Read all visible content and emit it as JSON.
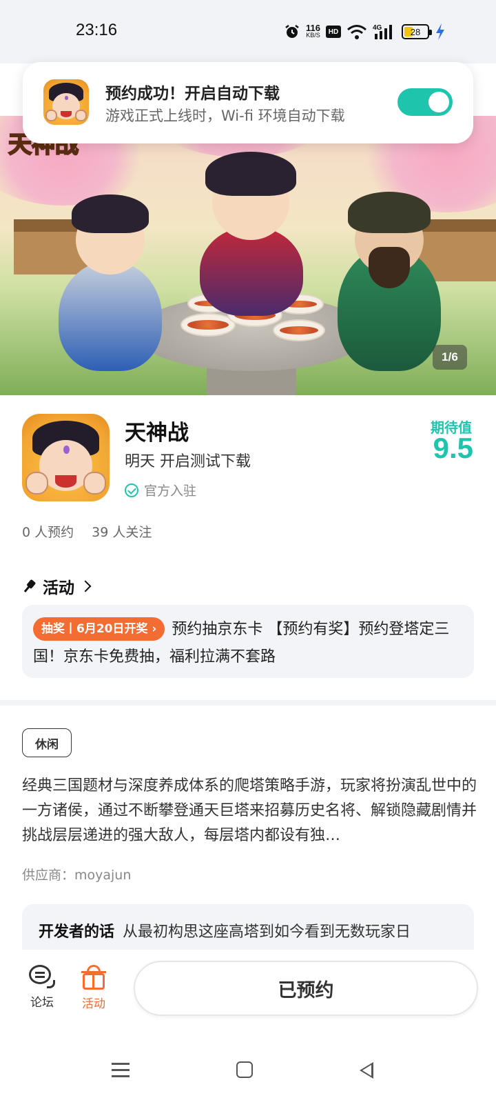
{
  "status_bar": {
    "time": "23:16",
    "net_speed_value": "116",
    "net_speed_unit": "KB/S",
    "hd_label": "HD",
    "network_label": "4G",
    "battery_level": "28",
    "icons": [
      "alarm-icon",
      "wifi-icon",
      "signal-icon",
      "battery-icon",
      "charging-icon"
    ]
  },
  "toast": {
    "title": "预约成功！开启自动下载",
    "subtitle": "游戏正式上线时，Wi-fi 环境自动下载",
    "toggle_on": true,
    "accent_color": "#1fc4ad"
  },
  "hero": {
    "logo_text": "天神战",
    "page_indicator": "1/6"
  },
  "game": {
    "name": "天神战",
    "status": "明天 开启测试下载",
    "official_label": "官方入驻",
    "expect_label": "期待值",
    "expect_value": "9.5",
    "reservations": "0 人预约",
    "followers": "39 人关注"
  },
  "activity": {
    "heading": "活动",
    "badge": "抽奖丨6月20日开奖 ›",
    "text": "预约抽京东卡 【预约有奖】预约登塔定三国！京东卡免费抽，福利拉满不套路",
    "badge_color": "#f36c31"
  },
  "details": {
    "tag": "休闲",
    "description": "经典三国题材与深度养成体系的爬塔策略手游，玩家将扮演乱世中的一方诸侯，通过不断攀登通天巨塔来招募历史名将、解锁隐藏剧情并挑战层层递进的强大敌人，每层塔内都设有独…",
    "supplier": "供应商：moyajun"
  },
  "developer": {
    "label": "开发者的话",
    "text": "从最初构思这座高塔到如今看到无数玩家日"
  },
  "bottom_bar": {
    "forum_label": "论坛",
    "activity_label": "活动",
    "reserved_button": "已预约",
    "active_color": "#f36c31"
  }
}
